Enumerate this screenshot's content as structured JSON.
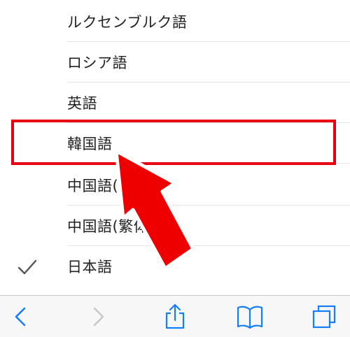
{
  "languages": [
    {
      "label": "ルクセンブルク語",
      "checked": false
    },
    {
      "label": "ロシア語",
      "checked": false
    },
    {
      "label": "英語",
      "checked": false
    },
    {
      "label": "韓国語",
      "checked": false
    },
    {
      "label": "中国語(",
      "checked": false
    },
    {
      "label": "中国語(繁体",
      "checked": false
    },
    {
      "label": "日本語",
      "checked": true
    }
  ],
  "colors": {
    "highlight": "#e60012",
    "accent": "#157efb",
    "disabled": "#c7c7cc"
  },
  "toolbar": {
    "icons": [
      "back-icon",
      "forward-icon",
      "share-icon",
      "bookmarks-icon",
      "tabs-icon"
    ]
  }
}
